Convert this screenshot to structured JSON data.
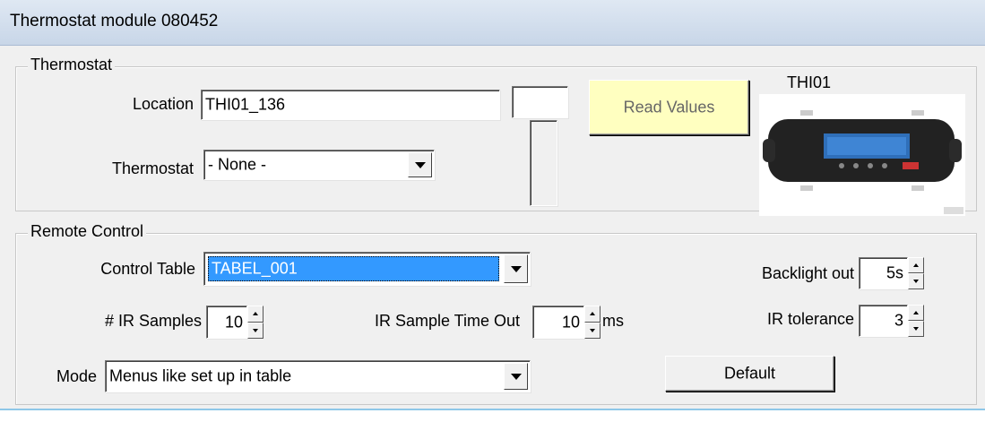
{
  "window": {
    "title": "Thermostat module 080452"
  },
  "thermostat_group": {
    "legend": "Thermostat",
    "location_label": "Location",
    "location_value": "THI01_136",
    "thermostat_label": "Thermostat",
    "thermostat_selected": "- None -",
    "read_values_label": "Read Values",
    "device_label": "THI01",
    "device_icon": "thermostat-device-image"
  },
  "remote_group": {
    "legend": "Remote Control",
    "control_table_label": "Control Table",
    "control_table_selected": "TABEL_001",
    "ir_samples_label": "# IR Samples",
    "ir_samples_value": "10",
    "ir_timeout_label": "IR Sample Time Out",
    "ir_timeout_value": "10",
    "ir_timeout_unit": "ms",
    "backlight_label": "Backlight out",
    "backlight_value": "5s",
    "ir_tolerance_label": "IR tolerance",
    "ir_tolerance_value": "3",
    "mode_label": "Mode",
    "mode_selected": "Menus like set up in table",
    "default_label": "Default"
  },
  "colors": {
    "selection": "#3399ff",
    "read_button": "#ffffc0",
    "form_background": "#f0f0f0"
  }
}
